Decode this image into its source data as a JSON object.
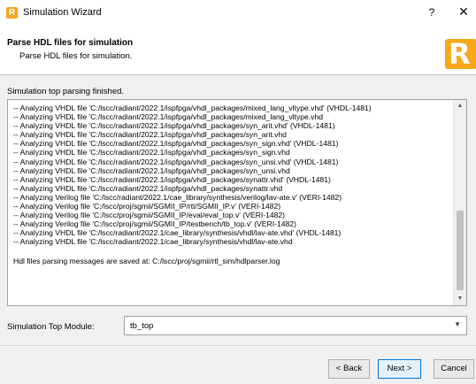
{
  "window": {
    "title": "Simulation Wizard",
    "help": "?",
    "close": "✕"
  },
  "header": {
    "title": "Parse HDL files for simulation",
    "subtitle": "Parse HDL files for simulation.",
    "logo_letter": "R"
  },
  "status": "Simulation top parsing finished.",
  "log": {
    "lines": [
      "-- Analyzing VHDL file 'C:/lscc/radiant/2022.1/ispfpga/vhdl_packages/mixed_lang_vltype.vhd' (VHDL-1481)",
      "-- Analyzing VHDL file 'C:/lscc/radiant/2022.1/ispfpga/vhdl_packages/mixed_lang_vltype.vhd",
      "-- Analyzing VHDL file 'C:/lscc/radiant/2022.1/ispfpga/vhdl_packages/syn_arit.vhd' (VHDL-1481)",
      "-- Analyzing VHDL file 'C:/lscc/radiant/2022.1/ispfpga/vhdl_packages/syn_arit.vhd",
      "-- Analyzing VHDL file 'C:/lscc/radiant/2022.1/ispfpga/vhdl_packages/syn_sign.vhd' (VHDL-1481)",
      "-- Analyzing VHDL file 'C:/lscc/radiant/2022.1/ispfpga/vhdl_packages/syn_sign.vhd",
      "-- Analyzing VHDL file 'C:/lscc/radiant/2022.1/ispfpga/vhdl_packages/syn_unsi.vhd' (VHDL-1481)",
      "-- Analyzing VHDL file 'C:/lscc/radiant/2022.1/ispfpga/vhdl_packages/syn_unsi.vhd",
      "-- Analyzing VHDL file 'C:/lscc/radiant/2022.1/ispfpga/vhdl_packages/synattr.vhd' (VHDL-1481)",
      "-- Analyzing VHDL file 'C:/lscc/radiant/2022.1/ispfpga/vhdl_packages/synattr.vhd",
      "-- Analyzing Verilog file 'C:/lscc/radiant/2022.1/cae_library/synthesis/verilog/lav-ate.v' (VERI-1482)",
      "-- Analyzing Verilog file 'C:/lscc/proj/sgmii/SGMII_IP/rtl/SGMII_IP.v' (VERI-1482)",
      "-- Analyzing Verilog file 'C:/lscc/proj/sgmii/SGMII_IP/eval/eval_top.v' (VERI-1482)",
      "-- Analyzing Verilog file 'C:/lscc/proj/sgmii/SGMII_IP/testbench/tb_top.v' (VERI-1482)",
      "-- Analyzing VHDL file 'C:/lscc/radiant/2022.1/cae_library/synthesis/vhdl/lav-ate.vhd' (VHDL-1481)",
      "-- Analyzing VHDL file 'C:/lscc/radiant/2022.1/cae_library/synthesis/vhdl/lav-ate.vhd"
    ],
    "summary": "Hdl files parsing messages are saved at: C:/lscc/proj/sgmii/rtl_sim/hdlparser.log"
  },
  "top_module": {
    "label": "Simulation Top Module:",
    "value": "tb_top"
  },
  "buttons": {
    "back": "< Back",
    "next": "Next >",
    "cancel": "Cancel"
  },
  "icons": {
    "app": "radiant-app-icon",
    "help": "help-icon",
    "close": "close-icon",
    "dropdown": "chevron-down-icon"
  },
  "colors": {
    "brand": "#f7a81b",
    "focus_border": "#0078d7"
  }
}
